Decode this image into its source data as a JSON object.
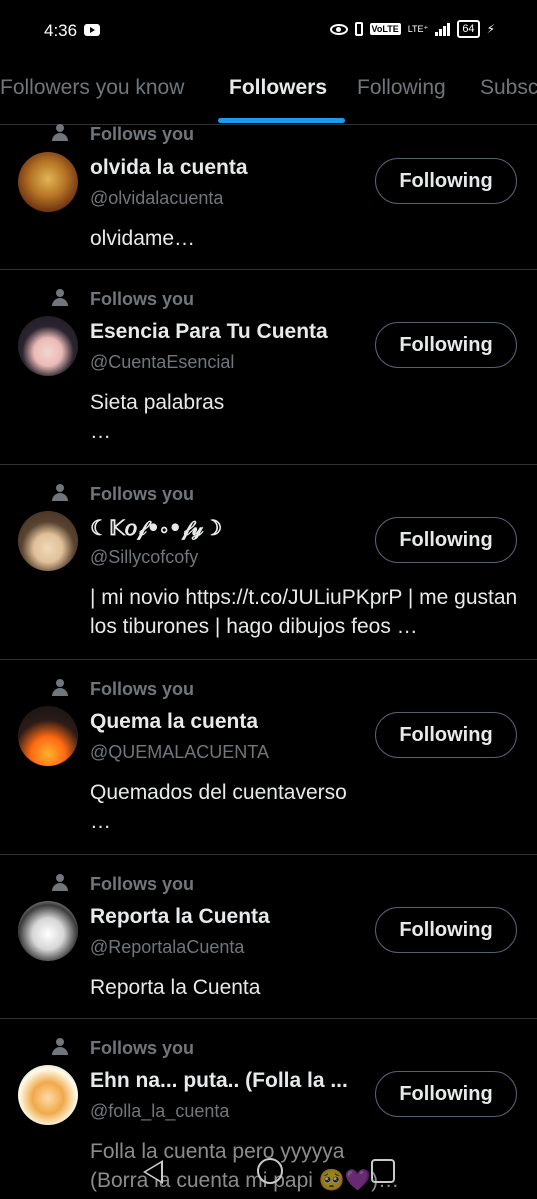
{
  "status_bar": {
    "time": "4:36",
    "volte": "VoLTE",
    "lte": "LTE⁺",
    "battery": "64",
    "icons": [
      "youtube-icon",
      "eye-icon",
      "vibrate-icon",
      "signal-icon",
      "battery-icon",
      "charging-icon"
    ]
  },
  "tabs": [
    {
      "label": "Followers you know"
    },
    {
      "label": "Followers"
    },
    {
      "label": "Following"
    },
    {
      "label": "Subscriptions"
    }
  ],
  "active_tab": "Followers",
  "accent_color": "#1d9bf0",
  "followers": [
    {
      "follows_you": "Follows you",
      "name": "olvida la cuenta",
      "handle": "@olvidalacuenta",
      "bio": "olvidame…",
      "button": "Following"
    },
    {
      "follows_you": "Follows you",
      "name": "Esencia Para Tu Cuenta",
      "handle": "@CuentaEsencial",
      "bio": "Sieta palabras\n…",
      "button": "Following"
    },
    {
      "follows_you": "Follows you",
      "name": "☾𝕂𝑜𝒻•⸰•𝒻𝓎☽",
      "handle": "@Sillycofcofy",
      "bio": "| mi novio https://t.co/JULiuPKprP | me gustan los tiburones | hago dibujos feos …",
      "button": "Following"
    },
    {
      "follows_you": "Follows you",
      "name": "Quema la cuenta",
      "handle": "@QUEMALACUENTA",
      "bio": "Quemados del cuentaverso\n…",
      "button": "Following"
    },
    {
      "follows_you": "Follows you",
      "name": "Reporta la Cuenta",
      "handle": "@ReportalaCuenta",
      "bio": "Reporta la Cuenta",
      "button": "Following"
    },
    {
      "follows_you": "Follows you",
      "name": "Ehn na... puta.. (Folla la ...",
      "handle": "@folla_la_cuenta",
      "bio": "Folla la cuenta pero yyyyya\n(Borra la cuenta mi papi 🥺💜)…",
      "button": "Following"
    }
  ],
  "nav_bar": {
    "icons": [
      "back-icon",
      "home-icon",
      "recents-icon"
    ]
  }
}
